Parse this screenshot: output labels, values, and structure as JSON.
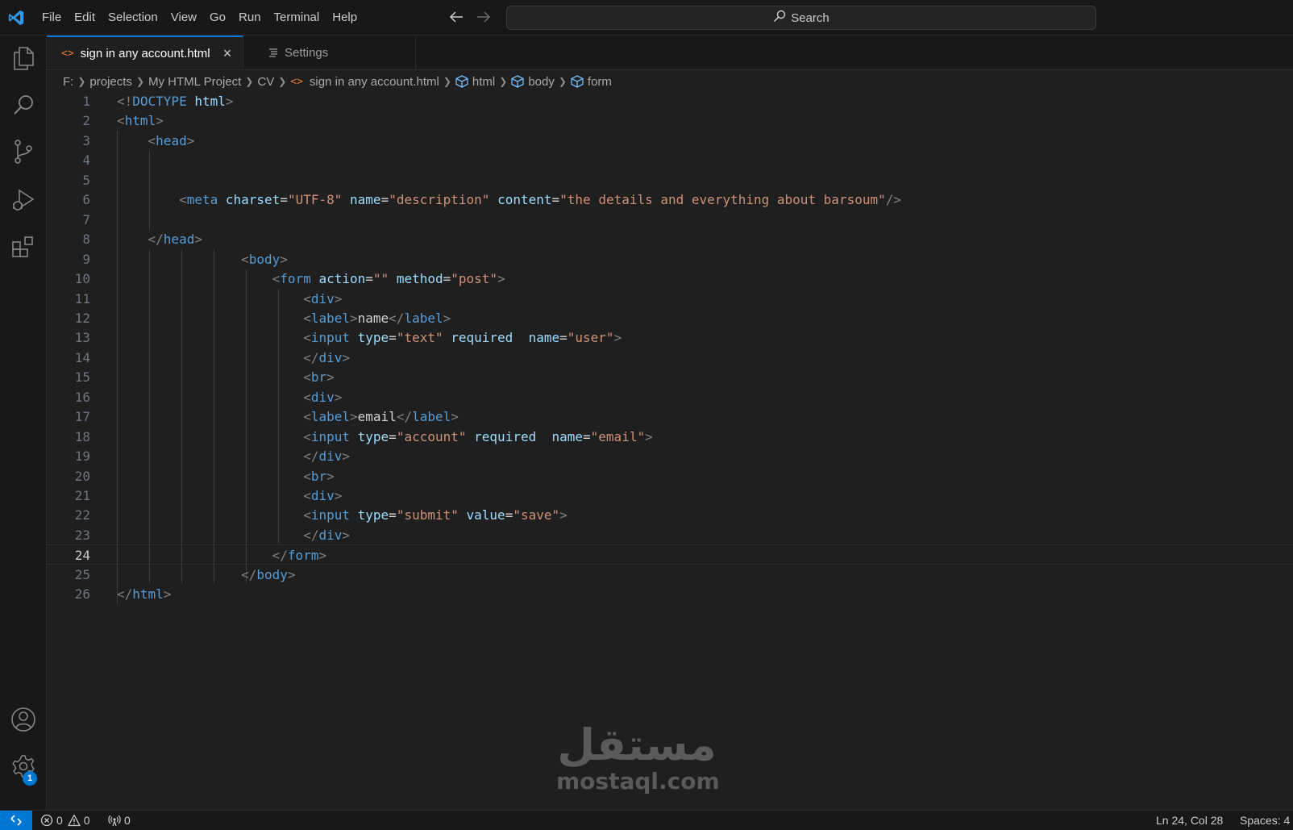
{
  "menu": [
    "File",
    "Edit",
    "Selection",
    "View",
    "Go",
    "Run",
    "Terminal",
    "Help"
  ],
  "search": {
    "label": "Search"
  },
  "tabs": [
    {
      "label": "sign in any account.html",
      "close": "×"
    },
    {
      "label": "Settings"
    }
  ],
  "breadcrumb": {
    "drive": "F:",
    "parts": [
      "projects",
      "My HTML Project",
      "CV"
    ],
    "file": "sign in any account.html",
    "symbols": [
      "html",
      "body",
      "form"
    ]
  },
  "editor": {
    "active_line": 24,
    "lines": [
      [
        [
          "p",
          "<!"
        ],
        [
          "t",
          "DOCTYPE"
        ],
        [
          "x",
          " "
        ],
        [
          "a",
          "html"
        ],
        [
          "p",
          ">"
        ]
      ],
      [
        [
          "p",
          "<"
        ],
        [
          "t",
          "html"
        ],
        [
          "p",
          ">"
        ]
      ],
      [
        [
          "x",
          "    "
        ],
        [
          "p",
          "<"
        ],
        [
          "t",
          "head"
        ],
        [
          "p",
          ">"
        ]
      ],
      [],
      [],
      [
        [
          "x",
          "        "
        ],
        [
          "p",
          "<"
        ],
        [
          "t",
          "meta"
        ],
        [
          "x",
          " "
        ],
        [
          "a",
          "charset"
        ],
        [
          "x",
          "="
        ],
        [
          "s",
          "\"UTF-8\""
        ],
        [
          "x",
          " "
        ],
        [
          "a",
          "name"
        ],
        [
          "x",
          "="
        ],
        [
          "s",
          "\"description\""
        ],
        [
          "x",
          " "
        ],
        [
          "a",
          "content"
        ],
        [
          "x",
          "="
        ],
        [
          "s",
          "\"the details and everything about barsoum\""
        ],
        [
          "p",
          "/>"
        ]
      ],
      [],
      [
        [
          "x",
          "    "
        ],
        [
          "p",
          "</"
        ],
        [
          "t",
          "head"
        ],
        [
          "p",
          ">"
        ]
      ],
      [
        [
          "x",
          "                "
        ],
        [
          "p",
          "<"
        ],
        [
          "t",
          "body"
        ],
        [
          "p",
          ">"
        ]
      ],
      [
        [
          "x",
          "                    "
        ],
        [
          "p",
          "<"
        ],
        [
          "t",
          "form"
        ],
        [
          "x",
          " "
        ],
        [
          "a",
          "action"
        ],
        [
          "x",
          "="
        ],
        [
          "s",
          "\"\""
        ],
        [
          "x",
          " "
        ],
        [
          "a",
          "method"
        ],
        [
          "x",
          "="
        ],
        [
          "s",
          "\"post\""
        ],
        [
          "p",
          ">"
        ]
      ],
      [
        [
          "x",
          "                        "
        ],
        [
          "p",
          "<"
        ],
        [
          "t",
          "div"
        ],
        [
          "p",
          ">"
        ]
      ],
      [
        [
          "x",
          "                        "
        ],
        [
          "p",
          "<"
        ],
        [
          "t",
          "label"
        ],
        [
          "p",
          ">"
        ],
        [
          "x",
          "name"
        ],
        [
          "p",
          "</"
        ],
        [
          "t",
          "label"
        ],
        [
          "p",
          ">"
        ]
      ],
      [
        [
          "x",
          "                        "
        ],
        [
          "p",
          "<"
        ],
        [
          "t",
          "input"
        ],
        [
          "x",
          " "
        ],
        [
          "a",
          "type"
        ],
        [
          "x",
          "="
        ],
        [
          "s",
          "\"text\""
        ],
        [
          "x",
          " "
        ],
        [
          "a",
          "required"
        ],
        [
          "x",
          "  "
        ],
        [
          "a",
          "name"
        ],
        [
          "x",
          "="
        ],
        [
          "s",
          "\"user\""
        ],
        [
          "p",
          ">"
        ]
      ],
      [
        [
          "x",
          "                        "
        ],
        [
          "p",
          "</"
        ],
        [
          "t",
          "div"
        ],
        [
          "p",
          ">"
        ]
      ],
      [
        [
          "x",
          "                        "
        ],
        [
          "p",
          "<"
        ],
        [
          "t",
          "br"
        ],
        [
          "p",
          ">"
        ]
      ],
      [
        [
          "x",
          "                        "
        ],
        [
          "p",
          "<"
        ],
        [
          "t",
          "div"
        ],
        [
          "p",
          ">"
        ]
      ],
      [
        [
          "x",
          "                        "
        ],
        [
          "p",
          "<"
        ],
        [
          "t",
          "label"
        ],
        [
          "p",
          ">"
        ],
        [
          "x",
          "email"
        ],
        [
          "p",
          "</"
        ],
        [
          "t",
          "label"
        ],
        [
          "p",
          ">"
        ]
      ],
      [
        [
          "x",
          "                        "
        ],
        [
          "p",
          "<"
        ],
        [
          "t",
          "input"
        ],
        [
          "x",
          " "
        ],
        [
          "a",
          "type"
        ],
        [
          "x",
          "="
        ],
        [
          "s",
          "\"account\""
        ],
        [
          "x",
          " "
        ],
        [
          "a",
          "required"
        ],
        [
          "x",
          "  "
        ],
        [
          "a",
          "name"
        ],
        [
          "x",
          "="
        ],
        [
          "s",
          "\"email\""
        ],
        [
          "p",
          ">"
        ]
      ],
      [
        [
          "x",
          "                        "
        ],
        [
          "p",
          "</"
        ],
        [
          "t",
          "div"
        ],
        [
          "p",
          ">"
        ]
      ],
      [
        [
          "x",
          "                        "
        ],
        [
          "p",
          "<"
        ],
        [
          "t",
          "br"
        ],
        [
          "p",
          ">"
        ]
      ],
      [
        [
          "x",
          "                        "
        ],
        [
          "p",
          "<"
        ],
        [
          "t",
          "div"
        ],
        [
          "p",
          ">"
        ]
      ],
      [
        [
          "x",
          "                        "
        ],
        [
          "p",
          "<"
        ],
        [
          "t",
          "input"
        ],
        [
          "x",
          " "
        ],
        [
          "a",
          "type"
        ],
        [
          "x",
          "="
        ],
        [
          "s",
          "\"submit\""
        ],
        [
          "x",
          " "
        ],
        [
          "a",
          "value"
        ],
        [
          "x",
          "="
        ],
        [
          "s",
          "\"save\""
        ],
        [
          "p",
          ">"
        ]
      ],
      [
        [
          "x",
          "                        "
        ],
        [
          "p",
          "</"
        ],
        [
          "t",
          "div"
        ],
        [
          "p",
          ">"
        ]
      ],
      [
        [
          "x",
          "                    "
        ],
        [
          "p",
          "</"
        ],
        [
          "t",
          "form"
        ],
        [
          "p",
          ">"
        ]
      ],
      [
        [
          "x",
          "                "
        ],
        [
          "p",
          "</"
        ],
        [
          "t",
          "body"
        ],
        [
          "p",
          ">"
        ]
      ],
      [
        [
          "p",
          "</"
        ],
        [
          "t",
          "html"
        ],
        [
          "p",
          ">"
        ]
      ]
    ]
  },
  "watermark": {
    "arabic": "مستقل",
    "latin": "mostaql.com"
  },
  "status": {
    "errors": "0",
    "warnings": "0",
    "ports": "0",
    "cursor": "Ln 24, Col 28",
    "spaces": "Spaces: 4"
  },
  "accounts_badge": "1",
  "colors": {
    "accent": "#0078d4",
    "tag": "#569cd6",
    "attr": "#9cdcfe",
    "string": "#ce9178",
    "punct": "#808080"
  }
}
